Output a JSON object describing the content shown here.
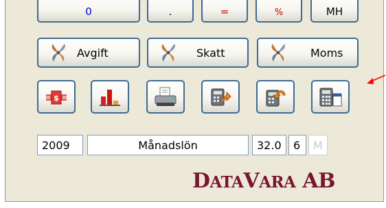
{
  "top_row": [
    {
      "label": "0",
      "color": "#0000cc"
    },
    {
      "label": ".",
      "color": "#000000"
    },
    {
      "label": "=",
      "color": "#cc0000"
    },
    {
      "label": "%",
      "color": "#cc0000"
    },
    {
      "label": "MH",
      "color": "#000000"
    }
  ],
  "tax_buttons": {
    "avgift": "Avgift",
    "skatt": "Skatt",
    "moms": "Moms",
    "icon": "fan-icon"
  },
  "tool_buttons": [
    {
      "icon": "currency-exchange-icon"
    },
    {
      "icon": "bar-chart-icon"
    },
    {
      "icon": "printer-icon"
    },
    {
      "icon": "calculator-export-icon"
    },
    {
      "icon": "calculator-undo-icon"
    },
    {
      "icon": "calculator-window-icon"
    }
  ],
  "fields": {
    "year": "2009",
    "period": "Månadslön",
    "rate": "32.0",
    "count": "6",
    "mode": "M"
  },
  "brand": {
    "prefix_big": "D",
    "prefix_small": "ATA",
    "middle_big": "V",
    "middle_small": "ARA",
    "suffix": " AB",
    "color": "#7a1530"
  },
  "pointer_arrow_color": "#ff0000"
}
